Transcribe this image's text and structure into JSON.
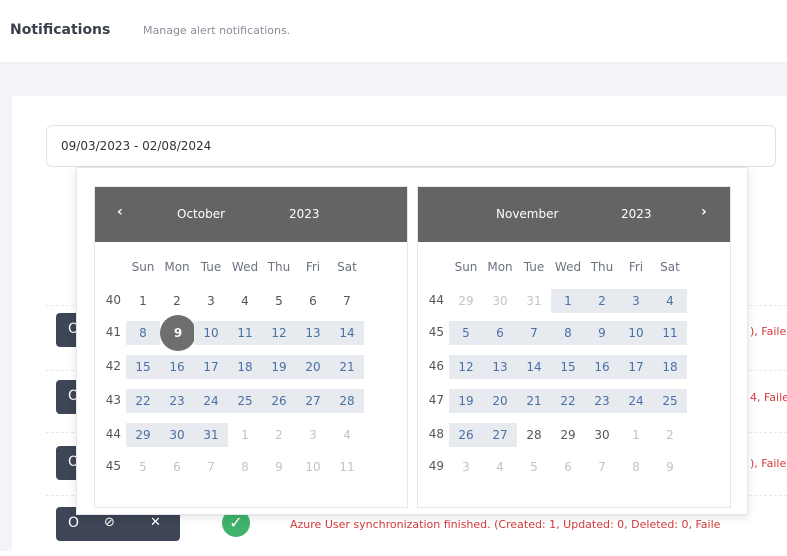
{
  "header": {
    "title": "Notifications",
    "subtitle": "Manage alert notifications."
  },
  "date_range": {
    "value": "09/03/2023 - 02/08/2024"
  },
  "calendars": [
    {
      "month": "October",
      "year": "2023",
      "nav": "‹",
      "dow": [
        "Sun",
        "Mon",
        "Tue",
        "Wed",
        "Thu",
        "Fri",
        "Sat"
      ],
      "weeks": [
        {
          "wk": "40",
          "days": [
            "1",
            "2",
            "3",
            "4",
            "5",
            "6",
            "7"
          ]
        },
        {
          "wk": "41",
          "days": [
            "8",
            "9",
            "10",
            "11",
            "12",
            "13",
            "14"
          ]
        },
        {
          "wk": "42",
          "days": [
            "15",
            "16",
            "17",
            "18",
            "19",
            "20",
            "21"
          ]
        },
        {
          "wk": "43",
          "days": [
            "22",
            "23",
            "24",
            "25",
            "26",
            "27",
            "28"
          ]
        },
        {
          "wk": "44",
          "days": [
            "29",
            "30",
            "31",
            "1",
            "2",
            "3",
            "4"
          ]
        },
        {
          "wk": "45",
          "days": [
            "5",
            "6",
            "7",
            "8",
            "9",
            "10",
            "11"
          ]
        }
      ]
    },
    {
      "month": "November",
      "year": "2023",
      "nav": "›",
      "dow": [
        "Sun",
        "Mon",
        "Tue",
        "Wed",
        "Thu",
        "Fri",
        "Sat"
      ],
      "weeks": [
        {
          "wk": "44",
          "days": [
            "29",
            "30",
            "31",
            "1",
            "2",
            "3",
            "4"
          ]
        },
        {
          "wk": "45",
          "days": [
            "5",
            "6",
            "7",
            "8",
            "9",
            "10",
            "11"
          ]
        },
        {
          "wk": "46",
          "days": [
            "12",
            "13",
            "14",
            "15",
            "16",
            "17",
            "18"
          ]
        },
        {
          "wk": "47",
          "days": [
            "19",
            "20",
            "21",
            "22",
            "23",
            "24",
            "25"
          ]
        },
        {
          "wk": "48",
          "days": [
            "26",
            "27",
            "28",
            "29",
            "30",
            "1",
            "2"
          ]
        },
        {
          "wk": "49",
          "days": [
            "3",
            "4",
            "5",
            "6",
            "7",
            "8",
            "9"
          ]
        }
      ]
    }
  ],
  "rows": [
    {
      "msg": "), Faile"
    },
    {
      "msg": "4, Faile"
    },
    {
      "msg": "), Faile"
    },
    {
      "msg": "Azure User synchronization finished. (Created: 1, Updated: 0, Deleted: 0, Faile"
    }
  ],
  "colors": {
    "header_bg": "#646464",
    "selected": "#6e6e6e",
    "range": "#e7ebef",
    "button": "#3d4556",
    "error": "#d23a3a",
    "success": "#3fb26b"
  }
}
